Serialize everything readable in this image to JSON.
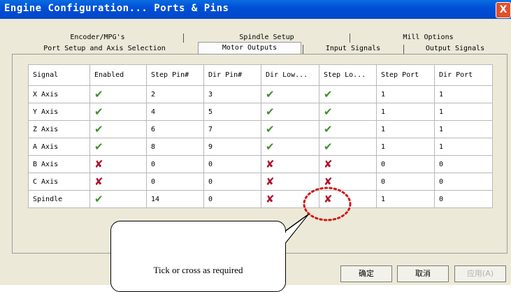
{
  "window": {
    "title": "Engine Configuration... Ports & Pins",
    "close_label": "X"
  },
  "tabs": {
    "row1": [
      "Encoder/MPG's",
      "Spindle Setup",
      "Mill Options"
    ],
    "row2": [
      "Port Setup and Axis Selection",
      "Motor Outputs",
      "Input Signals",
      "Output Signals"
    ],
    "active": "Motor Outputs"
  },
  "table": {
    "columns": [
      "Signal",
      "Enabled",
      "Step Pin#",
      "Dir Pin#",
      "Dir Low...",
      "Step Lo...",
      "Step Port",
      "Dir Port"
    ],
    "rows": [
      {
        "signal": "X Axis",
        "enabled": "✔",
        "step_pin": "2",
        "dir_pin": "3",
        "dir_low": "✔",
        "step_low": "✔",
        "step_port": "1",
        "dir_port": "1"
      },
      {
        "signal": "Y Axis",
        "enabled": "✔",
        "step_pin": "4",
        "dir_pin": "5",
        "dir_low": "✔",
        "step_low": "✔",
        "step_port": "1",
        "dir_port": "1"
      },
      {
        "signal": "Z Axis",
        "enabled": "✔",
        "step_pin": "6",
        "dir_pin": "7",
        "dir_low": "✔",
        "step_low": "✔",
        "step_port": "1",
        "dir_port": "1"
      },
      {
        "signal": "A Axis",
        "enabled": "✔",
        "step_pin": "8",
        "dir_pin": "9",
        "dir_low": "✔",
        "step_low": "✔",
        "step_port": "1",
        "dir_port": "1"
      },
      {
        "signal": "B Axis",
        "enabled": "✘",
        "step_pin": "0",
        "dir_pin": "0",
        "dir_low": "✘",
        "step_low": "✘",
        "step_port": "0",
        "dir_port": "0"
      },
      {
        "signal": "C Axis",
        "enabled": "✘",
        "step_pin": "0",
        "dir_pin": "0",
        "dir_low": "✘",
        "step_low": "✘",
        "step_port": "0",
        "dir_port": "0"
      },
      {
        "signal": "Spindle",
        "enabled": "✔",
        "step_pin": "14",
        "dir_pin": "0",
        "dir_low": "✘",
        "step_low": "✘",
        "step_port": "1",
        "dir_port": "0"
      }
    ]
  },
  "buttons": {
    "ok": "确定",
    "cancel": "取消",
    "apply": "应用(A)"
  },
  "annotation": {
    "text": "Tick or cross as required"
  },
  "colors": {
    "tick": "#3f8f2c",
    "cross": "#b0122a",
    "title_bar": "#0050d8",
    "highlight_circle": "#d01818"
  }
}
